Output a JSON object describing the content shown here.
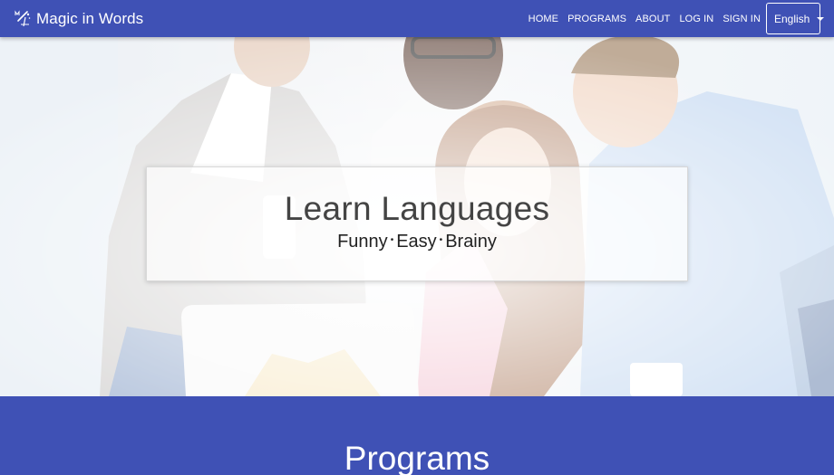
{
  "brand": {
    "name": "Magic in Words",
    "icon": "magic-wand-icon"
  },
  "nav": {
    "items": [
      {
        "label": "HOME"
      },
      {
        "label": "PROGRAMS"
      },
      {
        "label": "ABOUT"
      },
      {
        "label": "LOG IN"
      },
      {
        "label": "SIGN IN"
      }
    ],
    "language": {
      "selected": "English",
      "icon": "chevron-down-icon"
    }
  },
  "hero": {
    "title": "Learn Languages",
    "subtitle": {
      "parts": [
        "Funny",
        "Easy",
        "Brainy"
      ],
      "separator": "•"
    }
  },
  "programs": {
    "title": "Programs"
  },
  "colors": {
    "primary": "#3f51b5",
    "text_dark": "#444444",
    "white": "#ffffff"
  }
}
